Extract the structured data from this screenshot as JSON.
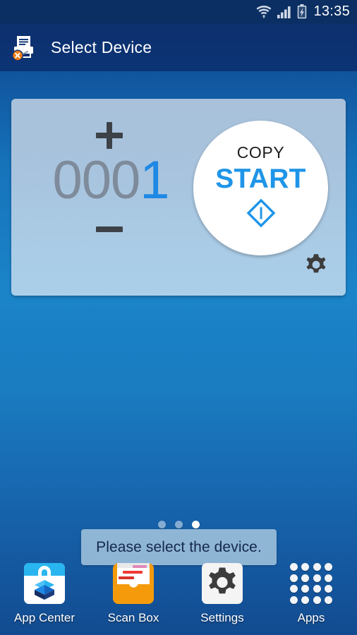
{
  "status_bar": {
    "time": "13:35",
    "icons": [
      "wifi-transfer-icon",
      "signal-bars-icon",
      "battery-charging-icon"
    ]
  },
  "title_bar": {
    "title": "Select Device",
    "icon": "printer-disconnected-icon"
  },
  "copy_card": {
    "increase_label": "+",
    "decrease_label": "–",
    "count_leading": "000",
    "count_value": "1",
    "count_full": "0001",
    "start_button": {
      "mode_label": "COPY",
      "action_label": "START",
      "icon": "diamond-start-icon"
    },
    "settings_icon": "gear-icon"
  },
  "page_indicator": {
    "total": 3,
    "active_index": 3
  },
  "toast": {
    "message": "Please select the device."
  },
  "dock": {
    "items": [
      {
        "label": "App Center",
        "icon": "app-center-bag-icon"
      },
      {
        "label": "Scan Box",
        "icon": "scan-box-folder-icon"
      },
      {
        "label": "Settings",
        "icon": "gear-icon"
      },
      {
        "label": "Apps",
        "icon": "apps-grid-icon"
      }
    ]
  },
  "colors": {
    "background_top": "#0a3a77",
    "background_mid": "#1b84c9",
    "background_bottom": "#124b90",
    "title_bar": "#0c3272",
    "status_bar": "#0b2f62",
    "card": "#a9c8e2",
    "accent_blue": "#1e88e5",
    "count_gray": "#7e8b9b",
    "scan_box_orange": "#f59b0b",
    "gear_dark": "#3c3c3c"
  }
}
